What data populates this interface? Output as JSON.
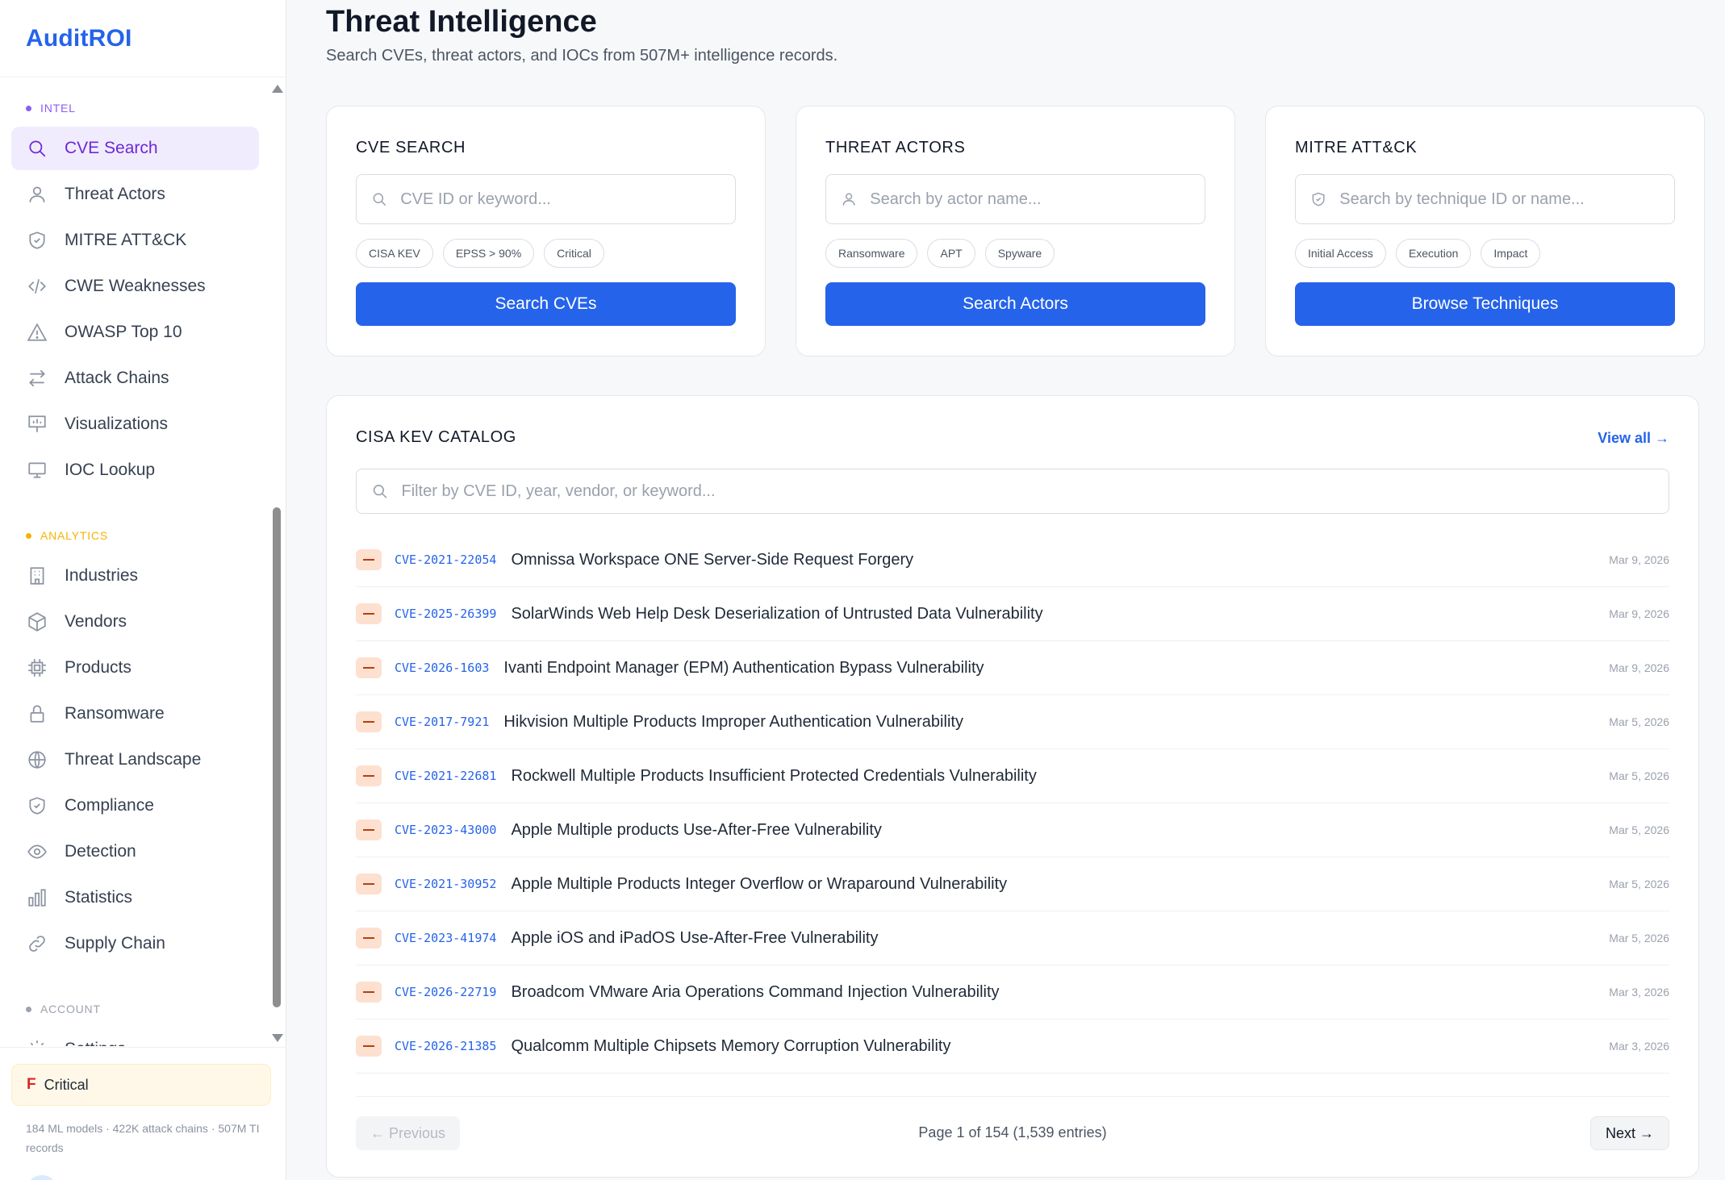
{
  "brand": "AuditROI",
  "sidebar": {
    "sections": [
      {
        "label": "INTEL",
        "color": "#8b5cf6",
        "items": [
          {
            "label": "CVE Search",
            "icon": "search-icon",
            "active": true
          },
          {
            "label": "Threat Actors",
            "icon": "user-icon"
          },
          {
            "label": "MITRE ATT&CK",
            "icon": "shield-icon"
          },
          {
            "label": "CWE Weaknesses",
            "icon": "code-icon"
          },
          {
            "label": "OWASP Top 10",
            "icon": "warning-icon"
          },
          {
            "label": "Attack Chains",
            "icon": "arrows-icon"
          },
          {
            "label": "Visualizations",
            "icon": "presentation-icon"
          },
          {
            "label": "IOC Lookup",
            "icon": "monitor-icon"
          }
        ]
      },
      {
        "label": "ANALYTICS",
        "color": "#f5b301",
        "items": [
          {
            "label": "Industries",
            "icon": "building-icon"
          },
          {
            "label": "Vendors",
            "icon": "cube-icon"
          },
          {
            "label": "Products",
            "icon": "chip-icon"
          },
          {
            "label": "Ransomware",
            "icon": "lock-icon"
          },
          {
            "label": "Threat Landscape",
            "icon": "globe-icon"
          },
          {
            "label": "Compliance",
            "icon": "shield-check-icon"
          },
          {
            "label": "Detection",
            "icon": "eye-icon"
          },
          {
            "label": "Statistics",
            "icon": "bar-chart-icon"
          },
          {
            "label": "Supply Chain",
            "icon": "link-icon"
          }
        ]
      },
      {
        "label": "ACCOUNT",
        "color": "#9ca3af",
        "items": [
          {
            "label": "Settings",
            "icon": "gear-icon"
          }
        ]
      }
    ],
    "grade": {
      "letter": "F",
      "label": "Critical"
    },
    "stats": "184 ML models · 422K attack chains · 507M TI records"
  },
  "page": {
    "title": "Threat Intelligence",
    "subtitle": "Search CVEs, threat actors, and IOCs from 507M+ intelligence records."
  },
  "cards": [
    {
      "title": "CVE SEARCH",
      "placeholder": "CVE ID or keyword...",
      "icon": "search-icon",
      "chips": [
        "CISA KEV",
        "EPSS > 90%",
        "Critical"
      ],
      "button": "Search CVEs"
    },
    {
      "title": "THREAT ACTORS",
      "placeholder": "Search by actor name...",
      "icon": "user-icon",
      "chips": [
        "Ransomware",
        "APT",
        "Spyware"
      ],
      "button": "Search Actors"
    },
    {
      "title": "MITRE ATT&CK",
      "placeholder": "Search by technique ID or name...",
      "icon": "shield-icon",
      "chips": [
        "Initial Access",
        "Execution",
        "Impact"
      ],
      "button": "Browse Techniques"
    }
  ],
  "kev": {
    "title": "CISA KEV CATALOG",
    "view_all": "View all →",
    "filter_placeholder": "Filter by CVE ID, year, vendor, or keyword...",
    "rows": [
      {
        "id": "CVE-2021-22054",
        "name": "Omnissa Workspace ONE Server-Side Request Forgery",
        "date": "Mar 9, 2026"
      },
      {
        "id": "CVE-2025-26399",
        "name": "SolarWinds Web Help Desk Deserialization of Untrusted Data Vulnerability",
        "date": "Mar 9, 2026"
      },
      {
        "id": "CVE-2026-1603",
        "name": "Ivanti Endpoint Manager (EPM) Authentication Bypass Vulnerability",
        "date": "Mar 9, 2026"
      },
      {
        "id": "CVE-2017-7921",
        "name": "Hikvision Multiple Products Improper Authentication Vulnerability",
        "date": "Mar 5, 2026"
      },
      {
        "id": "CVE-2021-22681",
        "name": "Rockwell Multiple Products Insufficient Protected Credentials Vulnerability",
        "date": "Mar 5, 2026"
      },
      {
        "id": "CVE-2023-43000",
        "name": "Apple Multiple products Use-After-Free Vulnerability",
        "date": "Mar 5, 2026"
      },
      {
        "id": "CVE-2021-30952",
        "name": "Apple Multiple Products Integer Overflow or Wraparound Vulnerability",
        "date": "Mar 5, 2026"
      },
      {
        "id": "CVE-2023-41974",
        "name": "Apple iOS and iPadOS Use-After-Free Vulnerability",
        "date": "Mar 5, 2026"
      },
      {
        "id": "CVE-2026-22719",
        "name": "Broadcom VMware Aria Operations Command Injection Vulnerability",
        "date": "Mar 3, 2026"
      },
      {
        "id": "CVE-2026-21385",
        "name": "Qualcomm Multiple Chipsets Memory Corruption Vulnerability",
        "date": "Mar 3, 2026"
      }
    ],
    "pager": {
      "prev": "← Previous",
      "info": "Page 1 of 154 (1,539 entries)",
      "next": "Next →"
    }
  },
  "colors": {
    "accent": "#2563eb",
    "active_nav": "#6d28d9",
    "severity": "#fde0cf"
  }
}
